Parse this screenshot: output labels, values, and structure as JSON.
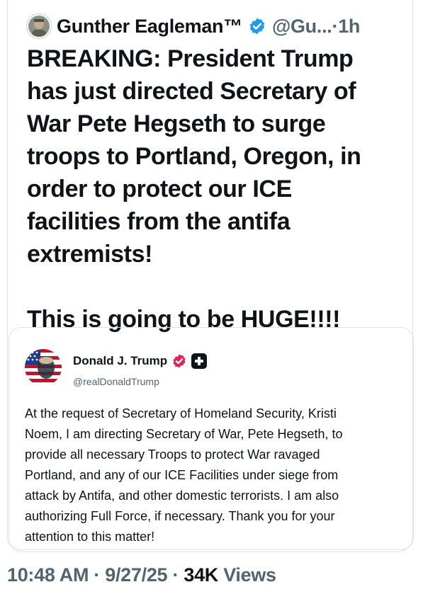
{
  "tweet": {
    "author_name": "Gunther Eagleman™",
    "handle": "@Gu...",
    "separator": "·",
    "time": "1h",
    "text_lines": [
      "BREAKING: President Trump",
      "has just directed Secretary of",
      "War Pete Hegseth to surge",
      "troops to Portland, Oregon, in",
      "order to protect our ICE",
      "facilities from the antifa",
      "extremists!"
    ],
    "text_line_final": "This is going to be HUGE!!!!"
  },
  "quote": {
    "author_name": "Donald J. Trump",
    "handle": "@realDonaldTrump",
    "text_lines": [
      "At the request of Secretary of Homeland Security, Kristi",
      "Noem, I am directing Secretary of War, Pete Hegseth, to",
      "provide all necessary Troops to protect War ravaged",
      "Portland, and any of our ICE Facilities under siege from",
      "attack by Antifa, and other domestic terrorists. I am also",
      "authorizing Full Force, if necessary. Thank you for your",
      "attention to this matter!"
    ]
  },
  "meta": {
    "time": "10:48 AM",
    "sep1": " · ",
    "date": "9/27/25",
    "sep2": " · ",
    "views_count": "34K",
    "views_label": " Views"
  },
  "icons": {
    "verified": "verified-badge-icon",
    "quote_verified": "pink-verified-badge-icon",
    "plus": "plus-badge-icon"
  },
  "colors": {
    "text": "#0f1419",
    "secondary": "#536471",
    "verified_blue": "#1d9bf0",
    "truth_pink": "#e0245e",
    "border": "#dfe3e8"
  }
}
